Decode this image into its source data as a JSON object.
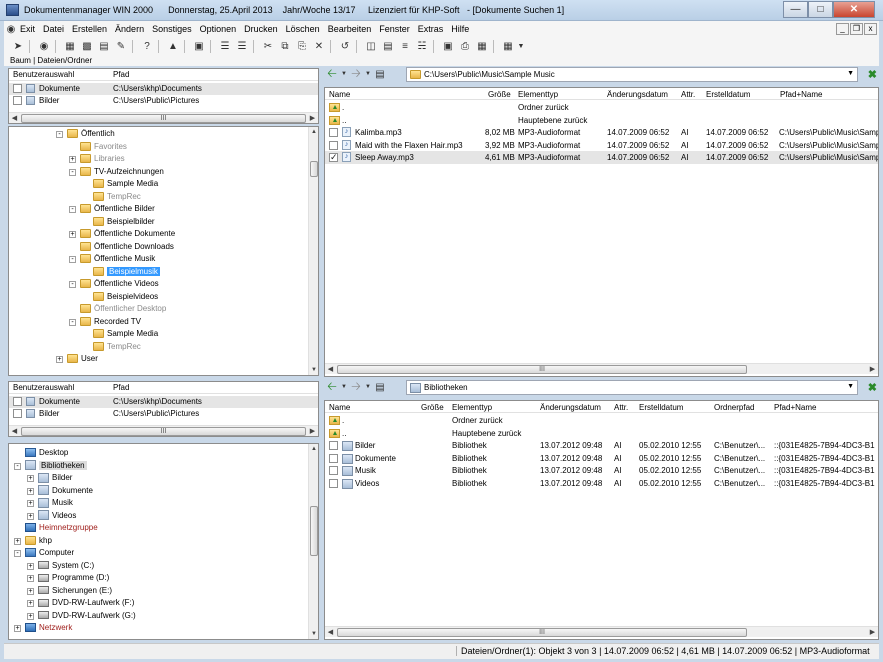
{
  "window": {
    "title": "Dokumentenmanager WIN 2000      Donnerstag, 25.April 2013    Jahr/Woche 13/17     Lizenziert für KHP-Soft   - [Dokumente Suchen 1]"
  },
  "menu": [
    "Exit",
    "Datei",
    "Erstellen",
    "Ändern",
    "Sonstiges",
    "Optionen",
    "Drucken",
    "Löschen",
    "Bearbeiten",
    "Fenster",
    "Extras",
    "Hilfe"
  ],
  "pane_tabs": "Baum | Dateien/Ordner",
  "top_left": {
    "headers": {
      "user": "Benutzerauswahl",
      "path": "Pfad"
    },
    "rows": [
      {
        "name": "Dokumente",
        "path": "C:\\Users\\khp\\Documents",
        "selected": true
      },
      {
        "name": "Bilder",
        "path": "C:\\Users\\Public\\Pictures",
        "selected": false
      }
    ],
    "scroll_mark": "III"
  },
  "tree1": [
    {
      "label": "Öffentlich",
      "level": 0,
      "exp": "-",
      "style": "normal"
    },
    {
      "label": "Favorites",
      "level": 1,
      "exp": "",
      "style": "gray"
    },
    {
      "label": "Libraries",
      "level": 1,
      "exp": "+",
      "style": "gray"
    },
    {
      "label": "TV-Aufzeichnungen",
      "level": 1,
      "exp": "-",
      "style": "normal"
    },
    {
      "label": "Sample Media",
      "level": 2,
      "exp": "",
      "style": "normal"
    },
    {
      "label": "TempRec",
      "level": 2,
      "exp": "",
      "style": "gray"
    },
    {
      "label": "Öffentliche Bilder",
      "level": 1,
      "exp": "-",
      "style": "normal"
    },
    {
      "label": "Beispielbilder",
      "level": 2,
      "exp": "",
      "style": "normal"
    },
    {
      "label": "Öffentliche Dokumente",
      "level": 1,
      "exp": "+",
      "style": "normal"
    },
    {
      "label": "Öffentliche Downloads",
      "level": 1,
      "exp": "",
      "style": "normal"
    },
    {
      "label": "Öffentliche Musik",
      "level": 1,
      "exp": "-",
      "style": "normal"
    },
    {
      "label": "Beispielmusik",
      "level": 2,
      "exp": "",
      "style": "selected"
    },
    {
      "label": "Öffentliche Videos",
      "level": 1,
      "exp": "-",
      "style": "normal"
    },
    {
      "label": "Beispielvideos",
      "level": 2,
      "exp": "",
      "style": "normal"
    },
    {
      "label": "Öffentlicher Desktop",
      "level": 1,
      "exp": "",
      "style": "gray"
    },
    {
      "label": "Recorded TV",
      "level": 1,
      "exp": "-",
      "style": "normal"
    },
    {
      "label": "Sample Media",
      "level": 2,
      "exp": "",
      "style": "normal"
    },
    {
      "label": "TempRec",
      "level": 2,
      "exp": "",
      "style": "gray"
    },
    {
      "label": "User",
      "level": 0,
      "exp": "+",
      "style": "normal"
    }
  ],
  "bottom_left": {
    "headers": {
      "user": "Benutzerauswahl",
      "path": "Pfad"
    },
    "rows": [
      {
        "name": "Dokumente",
        "path": "C:\\Users\\khp\\Documents",
        "selected": true
      },
      {
        "name": "Bilder",
        "path": "C:\\Users\\Public\\Pictures",
        "selected": false
      }
    ],
    "scroll_mark": "III"
  },
  "tree2": [
    {
      "label": "Desktop",
      "level": 0,
      "exp": "",
      "icon": "desktop",
      "style": "normal"
    },
    {
      "label": "Bibliotheken",
      "level": 0,
      "exp": "-",
      "icon": "lib",
      "style": "hl"
    },
    {
      "label": "Bilder",
      "level": 1,
      "exp": "+",
      "icon": "lib",
      "style": "normal"
    },
    {
      "label": "Dokumente",
      "level": 1,
      "exp": "+",
      "icon": "lib",
      "style": "normal"
    },
    {
      "label": "Musik",
      "level": 1,
      "exp": "+",
      "icon": "lib",
      "style": "normal"
    },
    {
      "label": "Videos",
      "level": 1,
      "exp": "+",
      "icon": "lib",
      "style": "normal"
    },
    {
      "label": "Heimnetzgruppe",
      "level": 0,
      "exp": "",
      "icon": "net",
      "style": "red"
    },
    {
      "label": "khp",
      "level": 0,
      "exp": "+",
      "icon": "folder",
      "style": "normal"
    },
    {
      "label": "Computer",
      "level": 0,
      "exp": "-",
      "icon": "pc",
      "style": "normal"
    },
    {
      "label": "System (C:)",
      "level": 1,
      "exp": "+",
      "icon": "drive",
      "style": "normal"
    },
    {
      "label": "Programme (D:)",
      "level": 1,
      "exp": "+",
      "icon": "drive",
      "style": "normal"
    },
    {
      "label": "Sicherungen (E:)",
      "level": 1,
      "exp": "+",
      "icon": "drive",
      "style": "normal"
    },
    {
      "label": "DVD-RW-Laufwerk (F:)",
      "level": 1,
      "exp": "+",
      "icon": "drive",
      "style": "normal"
    },
    {
      "label": "DVD-RW-Laufwerk (G:)",
      "level": 1,
      "exp": "+",
      "icon": "drive",
      "style": "normal"
    },
    {
      "label": "Netzwerk",
      "level": 0,
      "exp": "+",
      "icon": "net",
      "style": "red"
    }
  ],
  "top_right": {
    "path": "C:\\Users\\Public\\Music\\Sample Music",
    "headers": [
      "Name",
      "Größe",
      "Elementtyp",
      "Änderungsdatum",
      "Attr.",
      "Erstelldatum",
      "Pfad+Name"
    ],
    "nav_rows": [
      {
        "name": ".",
        "type": "Ordner zurück"
      },
      {
        "name": "..",
        "type": "Hauptebene zurück"
      }
    ],
    "files": [
      {
        "name": "Kalimba.mp3",
        "size": "8,02 MB",
        "type": "MP3-Audioformat",
        "modified": "14.07.2009 06:52",
        "attr": "AI",
        "created": "14.07.2009 06:52",
        "path": "C:\\Users\\Public\\Music\\Samp",
        "checked": false,
        "selected": false
      },
      {
        "name": "Maid with the Flaxen Hair.mp3",
        "size": "3,92 MB",
        "type": "MP3-Audioformat",
        "modified": "14.07.2009 06:52",
        "attr": "AI",
        "created": "14.07.2009 06:52",
        "path": "C:\\Users\\Public\\Music\\Samp",
        "checked": false,
        "selected": false
      },
      {
        "name": "Sleep Away.mp3",
        "size": "4,61 MB",
        "type": "MP3-Audioformat",
        "modified": "14.07.2009 06:52",
        "attr": "AI",
        "created": "14.07.2009 06:52",
        "path": "C:\\Users\\Public\\Music\\Samp",
        "checked": true,
        "selected": true
      }
    ],
    "scroll_mark": "III"
  },
  "bottom_right": {
    "path": "Bibliotheken",
    "headers": [
      "Name",
      "Größe",
      "Elementtyp",
      "Änderungsdatum",
      "Attr.",
      "Erstelldatum",
      "Ordnerpfad",
      "Pfad+Name"
    ],
    "nav_rows": [
      {
        "name": ".",
        "type": "Ordner zurück"
      },
      {
        "name": "..",
        "type": "Hauptebene zurück"
      }
    ],
    "items": [
      {
        "name": "Bilder",
        "type": "Bibliothek",
        "modified": "13.07.2012 09:48",
        "attr": "AI",
        "created": "05.02.2010 12:55",
        "folder": "C:\\Benutzer\\...",
        "path": "::{031E4825-7B94-4DC3-B1"
      },
      {
        "name": "Dokumente",
        "type": "Bibliothek",
        "modified": "13.07.2012 09:48",
        "attr": "AI",
        "created": "05.02.2010 12:55",
        "folder": "C:\\Benutzer\\...",
        "path": "::{031E4825-7B94-4DC3-B1"
      },
      {
        "name": "Musik",
        "type": "Bibliothek",
        "modified": "13.07.2012 09:48",
        "attr": "AI",
        "created": "05.02.2010 12:55",
        "folder": "C:\\Benutzer\\...",
        "path": "::{031E4825-7B94-4DC3-B1"
      },
      {
        "name": "Videos",
        "type": "Bibliothek",
        "modified": "13.07.2012 09:48",
        "attr": "AI",
        "created": "05.02.2010 12:55",
        "folder": "C:\\Benutzer\\...",
        "path": "::{031E4825-7B94-4DC3-B1"
      }
    ],
    "scroll_mark": "III"
  },
  "status": "Dateien/Ordner(1): Objekt 3 von 3 | 14.07.2009 06:52 | 4,61 MB | 14.07.2009 06:52 | MP3-Audioformat"
}
